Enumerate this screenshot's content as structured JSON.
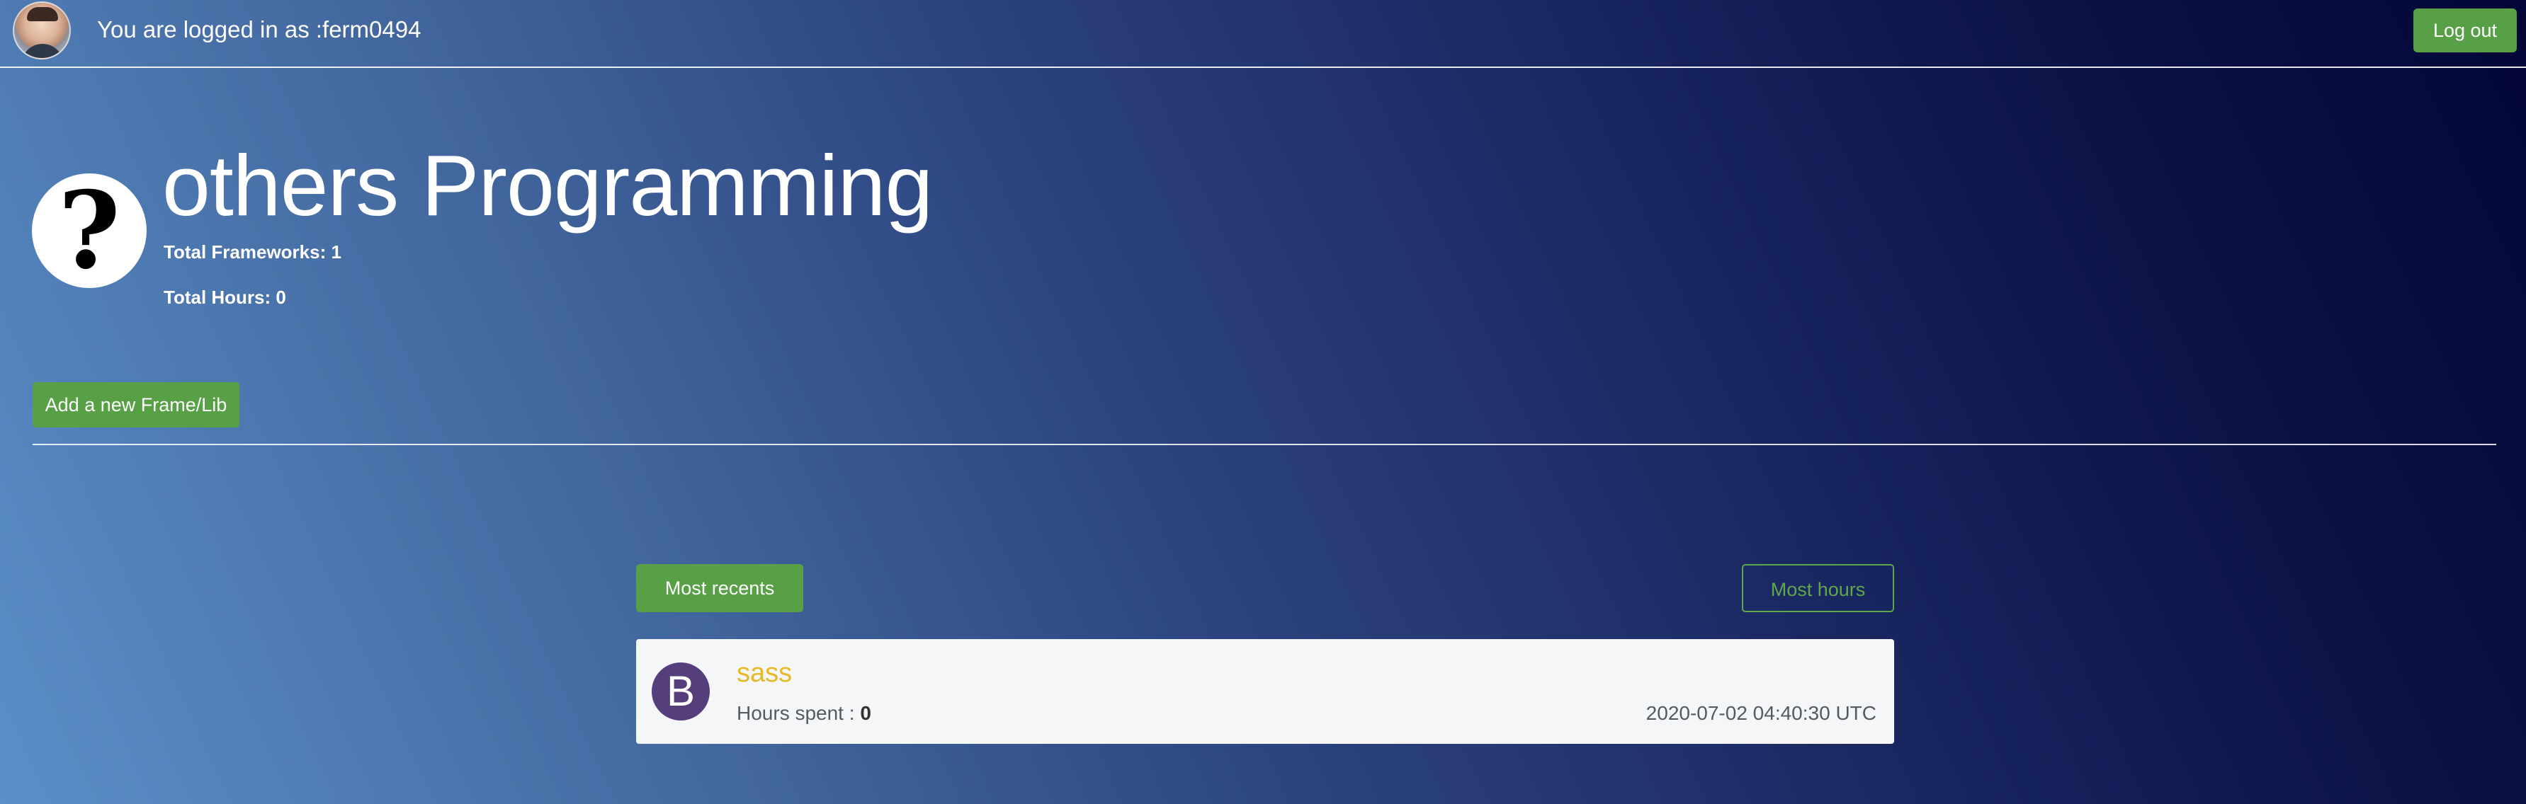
{
  "navbar": {
    "login_prefix": "You are logged in as :",
    "username": "ferm0494",
    "logout_label": "Log out"
  },
  "language": {
    "icon_glyph": "?",
    "title": "others Programming",
    "total_frameworks_label": "Total Frameworks:",
    "total_frameworks_value": "1",
    "total_hours_label": "Total Hours:",
    "total_hours_value": "0"
  },
  "actions": {
    "add_label": "Add a new Frame/Lib"
  },
  "sort": {
    "recent_label": "Most recents",
    "hours_label": "Most hours"
  },
  "frameworks": [
    {
      "logo_letter": "B",
      "name": "sass",
      "hours_label": "Hours spent :",
      "hours_value": "0",
      "date": "2020-07-02 04:40:30 UTC"
    }
  ],
  "colors": {
    "accent_green": "#58a045",
    "framework_name": "#e7b925",
    "logo_purple": "#563d7c"
  }
}
